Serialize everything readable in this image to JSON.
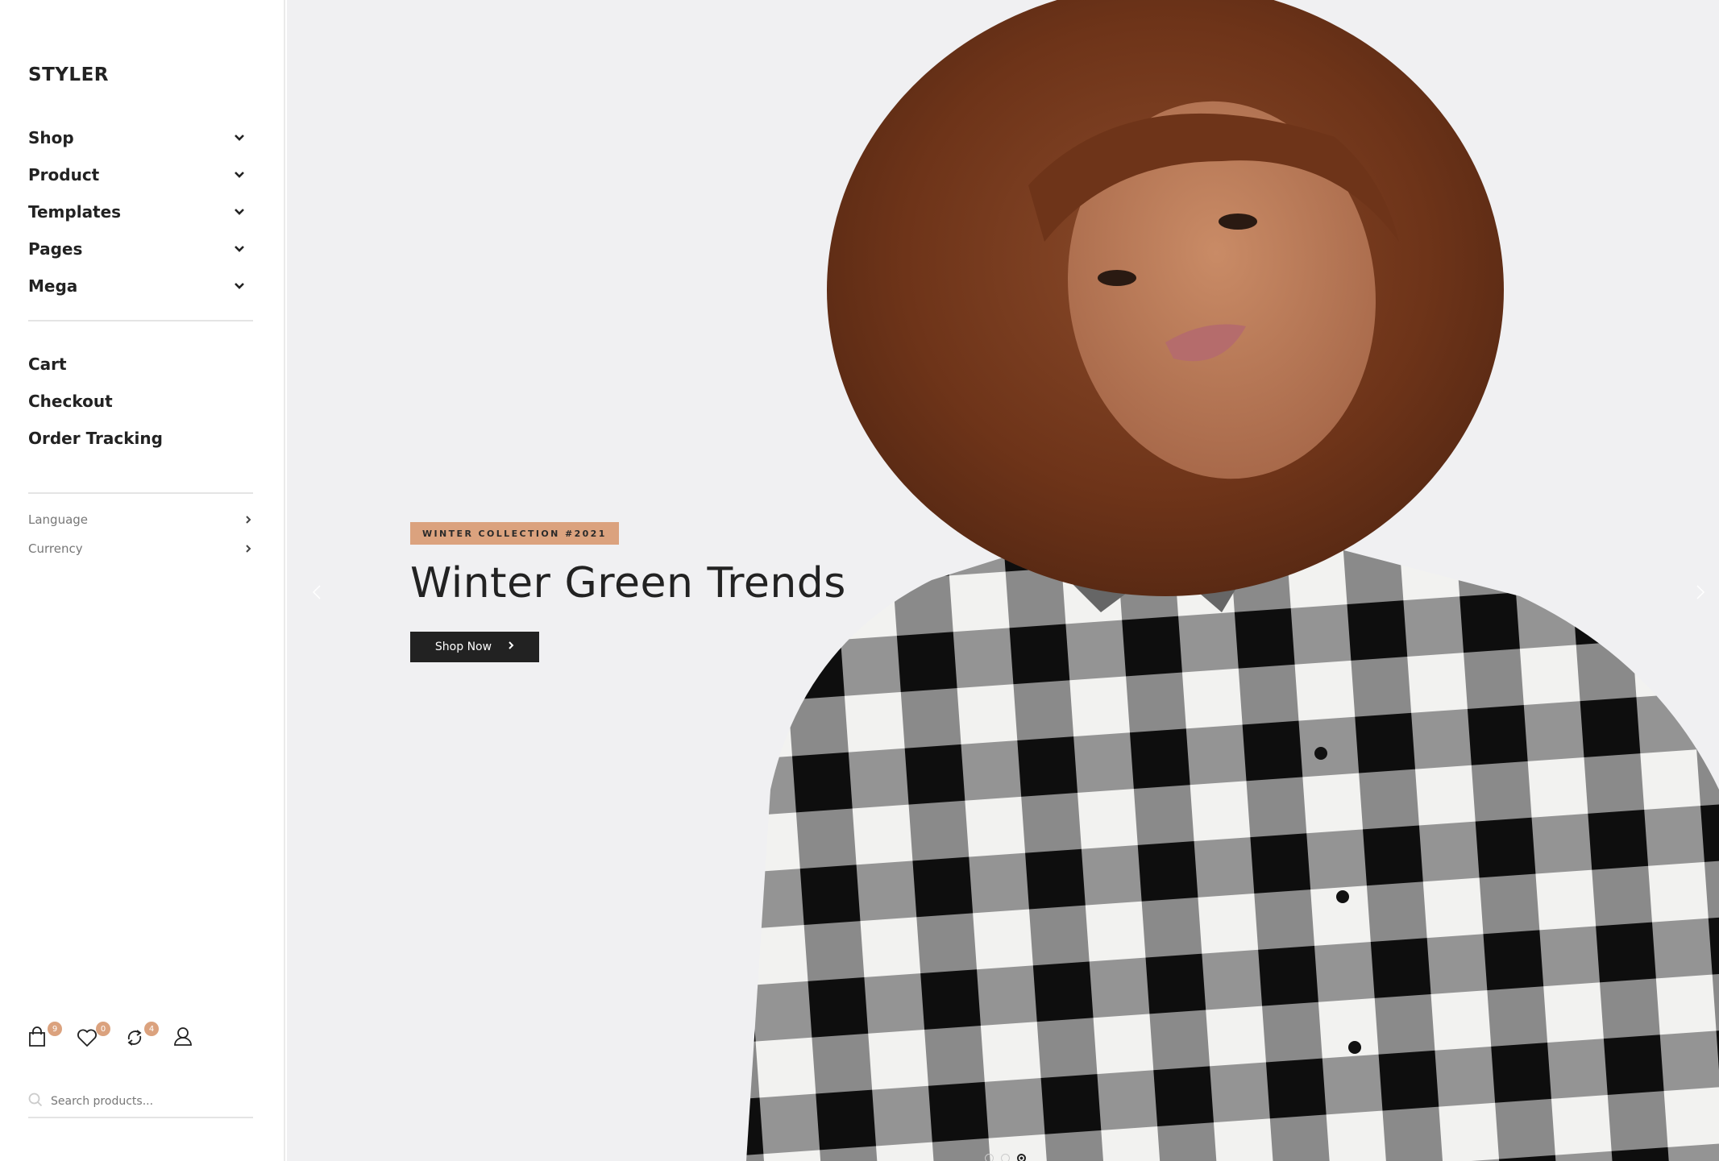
{
  "brand": {
    "logo": "STYLER"
  },
  "sidebar": {
    "menu": [
      {
        "label": "Shop",
        "icon": "chevron-down-icon"
      },
      {
        "label": "Product",
        "icon": "chevron-down-icon"
      },
      {
        "label": "Templates",
        "icon": "chevron-down-icon"
      },
      {
        "label": "Pages",
        "icon": "chevron-down-icon"
      },
      {
        "label": "Mega",
        "icon": "chevron-down-icon"
      }
    ],
    "links": [
      {
        "label": "Cart"
      },
      {
        "label": "Checkout"
      },
      {
        "label": "Order Tracking"
      }
    ],
    "settings": [
      {
        "label": "Language",
        "icon": "chevron-right-icon"
      },
      {
        "label": "Currency",
        "icon": "chevron-right-icon"
      }
    ],
    "icons": [
      {
        "name": "cart-icon",
        "badge": "9"
      },
      {
        "name": "wishlist-icon",
        "badge": "0"
      },
      {
        "name": "compare-icon",
        "badge": "4"
      },
      {
        "name": "account-icon",
        "badge": null
      }
    ],
    "search": {
      "placeholder": "Search products...",
      "value": ""
    }
  },
  "hero": {
    "tag": "WINTER COLLECTION #2021",
    "headline": "Winter Green Trends",
    "button_label": "Shop Now",
    "slides_total": 3,
    "active_slide": 3
  },
  "colors": {
    "accent": "#dba27e",
    "text": "#222222",
    "muted": "#777777",
    "hero_bg": "#f0f0f2",
    "button_bg": "#222222"
  }
}
